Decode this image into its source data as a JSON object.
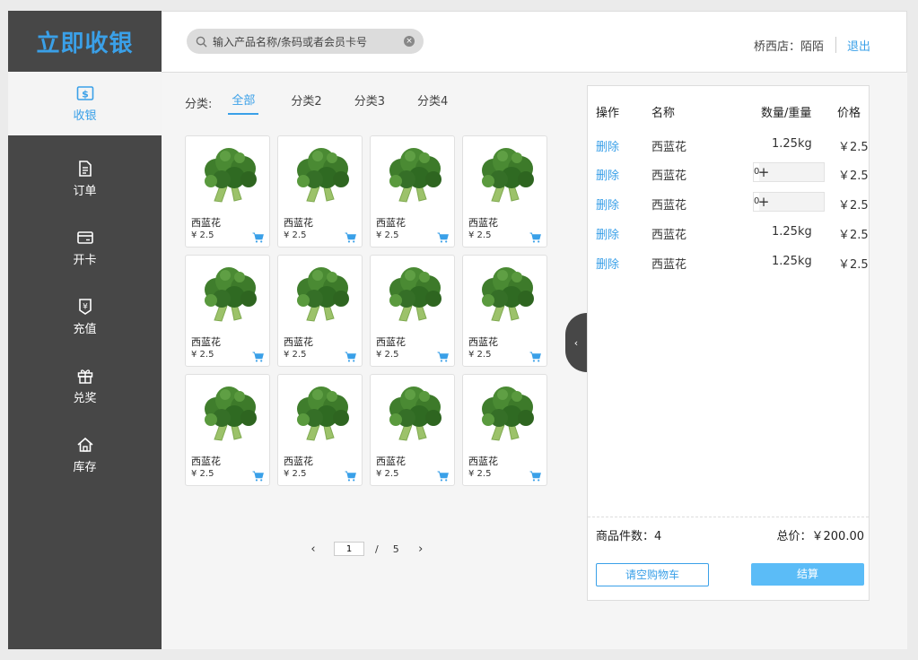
{
  "app": {
    "title": "立即收银"
  },
  "sidebar": {
    "items": [
      {
        "label": "收银",
        "icon": "cash-icon"
      },
      {
        "label": "订单",
        "icon": "document-icon"
      },
      {
        "label": "开卡",
        "icon": "card-icon"
      },
      {
        "label": "充值",
        "icon": "yen-shield-icon"
      },
      {
        "label": "兑奖",
        "icon": "gift-icon"
      },
      {
        "label": "库存",
        "icon": "home-icon"
      }
    ]
  },
  "header": {
    "search_placeholder": "输入产品名称/条码或者会员卡号",
    "store": "桥西店：陌陌",
    "logout": "退出"
  },
  "categories": {
    "label": "分类:",
    "tabs": [
      "全部",
      "分类2",
      "分类3",
      "分类4"
    ]
  },
  "products": [
    {
      "name": "西蓝花",
      "price": "¥ 2.5"
    },
    {
      "name": "西蓝花",
      "price": "¥ 2.5"
    },
    {
      "name": "西蓝花",
      "price": "¥ 2.5"
    },
    {
      "name": "西蓝花",
      "price": "¥ 2.5"
    },
    {
      "name": "西蓝花",
      "price": "¥ 2.5"
    },
    {
      "name": "西蓝花",
      "price": "¥ 2.5"
    },
    {
      "name": "西蓝花",
      "price": "¥ 2.5"
    },
    {
      "name": "西蓝花",
      "price": "¥ 2.5"
    },
    {
      "name": "西蓝花",
      "price": "¥ 2.5"
    },
    {
      "name": "西蓝花",
      "price": "¥ 2.5"
    },
    {
      "name": "西蓝花",
      "price": "¥ 2.5"
    },
    {
      "name": "西蓝花",
      "price": "¥ 2.5"
    }
  ],
  "pager": {
    "current": "1",
    "separator": "/",
    "total": "5"
  },
  "cart": {
    "headers": {
      "op": "操作",
      "name": "名称",
      "qty": "数量/重量",
      "price": "价格"
    },
    "rows": [
      {
        "op": "删除",
        "name": "西蓝花",
        "qty": "1.25kg",
        "price": "￥2.5"
      },
      {
        "op": "删除",
        "name": "西蓝花",
        "stepper": "0",
        "price": "￥2.5"
      },
      {
        "op": "删除",
        "name": "西蓝花",
        "stepper": "0",
        "price": "￥2.5"
      },
      {
        "op": "删除",
        "name": "西蓝花",
        "qty": "1.25kg",
        "price": "￥2.5"
      },
      {
        "op": "删除",
        "name": "西蓝花",
        "qty": "1.25kg",
        "price": "￥2.5"
      }
    ],
    "count_label": "商品件数：4",
    "total_label": "总价：￥200.00",
    "clear_label": "请空购物车",
    "pay_label": "结算"
  },
  "colors": {
    "accent": "#3aa0e8",
    "sidebar": "#474747",
    "pay": "#5bbcf7"
  }
}
